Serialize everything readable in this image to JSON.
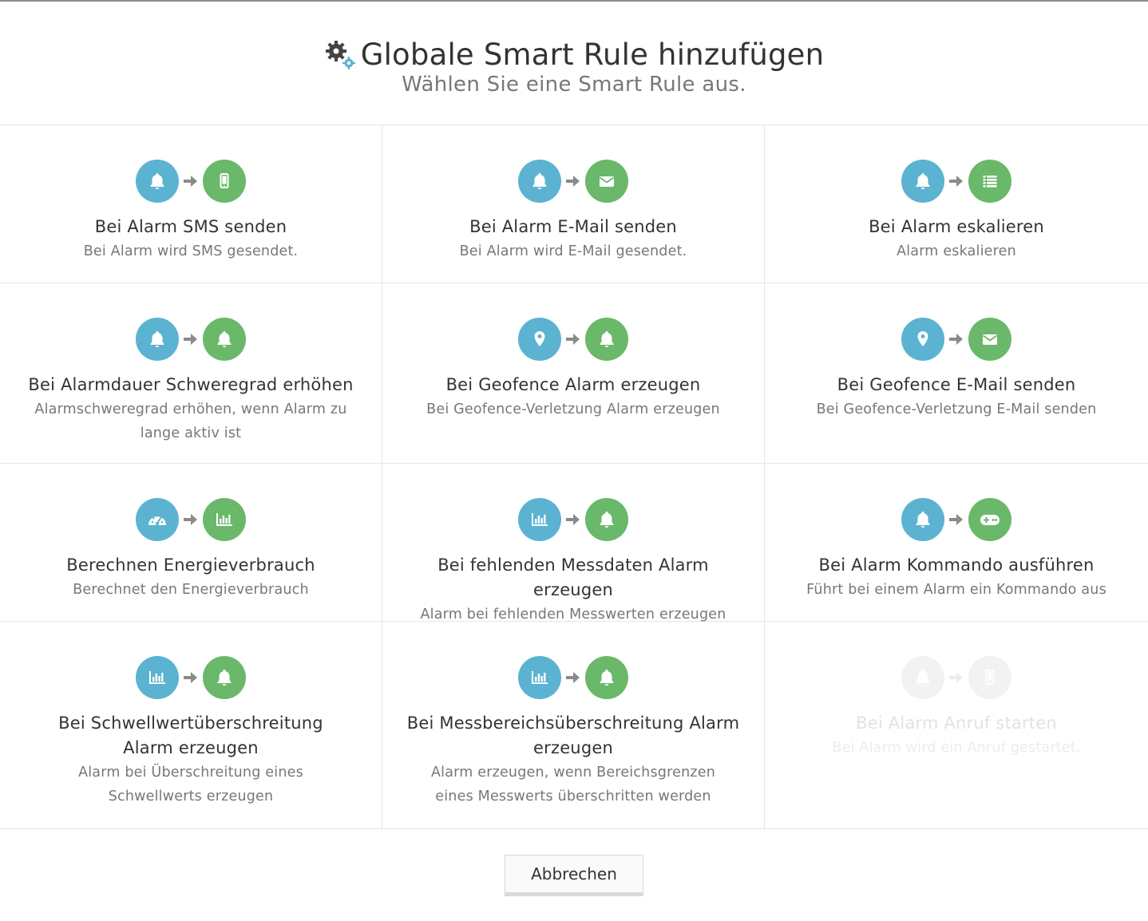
{
  "header": {
    "title": "Globale Smart Rule hinzufügen",
    "subtitle": "Wählen Sie eine Smart Rule aus."
  },
  "colors": {
    "trigger": "#5bb3d1",
    "action": "#6ab86a",
    "disabled": "#f2f2f2",
    "arrow": "#8a8a8a"
  },
  "rules": [
    {
      "title": "Bei Alarm SMS senden",
      "desc": "Bei Alarm wird SMS gesendet.",
      "from_icon": "bell-icon",
      "to_icon": "phone-icon",
      "enabled": true
    },
    {
      "title": "Bei Alarm E-Mail senden",
      "desc": "Bei Alarm wird E-Mail gesendet.",
      "from_icon": "bell-icon",
      "to_icon": "envelope-icon",
      "enabled": true
    },
    {
      "title": "Bei Alarm eskalieren",
      "desc": "Alarm eskalieren",
      "from_icon": "bell-icon",
      "to_icon": "list-icon",
      "enabled": true
    },
    {
      "title": "Bei Alarmdauer Schweregrad erhöhen",
      "desc": "Alarmschweregrad erhöhen, wenn Alarm zu lange aktiv ist",
      "from_icon": "bell-icon",
      "to_icon": "bell-icon",
      "enabled": true
    },
    {
      "title": "Bei Geofence Alarm erzeugen",
      "desc": "Bei Geofence-Verletzung Alarm erzeugen",
      "from_icon": "map-marker-icon",
      "to_icon": "bell-icon",
      "enabled": true
    },
    {
      "title": "Bei Geofence E-Mail senden",
      "desc": "Bei Geofence-Verletzung E-Mail senden",
      "from_icon": "map-marker-icon",
      "to_icon": "envelope-icon",
      "enabled": true
    },
    {
      "title": "Berechnen Energieverbrauch",
      "desc": "Berechnet den Energieverbrauch",
      "from_icon": "gauge-icon",
      "to_icon": "bar-chart-icon",
      "enabled": true
    },
    {
      "title": "Bei fehlenden Messdaten Alarm erzeugen",
      "desc": "Alarm bei fehlenden Messwerten erzeugen",
      "from_icon": "bar-chart-icon",
      "to_icon": "bell-icon",
      "enabled": true
    },
    {
      "title": "Bei Alarm Kommando ausführen",
      "desc": "Führt bei einem Alarm ein Kommando aus",
      "from_icon": "bell-icon",
      "to_icon": "gamepad-icon",
      "enabled": true
    },
    {
      "title": "Bei Schwellwertüberschreitung Alarm erzeugen",
      "desc": "Alarm bei Überschreitung eines Schwellwerts erzeugen",
      "from_icon": "bar-chart-icon",
      "to_icon": "bell-icon",
      "enabled": true
    },
    {
      "title": "Bei Messbereichsüberschreitung Alarm erzeugen",
      "desc": "Alarm erzeugen, wenn Bereichsgrenzen eines Messwerts überschritten werden",
      "from_icon": "bar-chart-icon",
      "to_icon": "bell-icon",
      "enabled": true
    },
    {
      "title": "Bei Alarm Anruf starten",
      "desc": "Bei Alarm wird ein Anruf gestartet.",
      "from_icon": "bell-icon",
      "to_icon": "phone-icon",
      "enabled": false
    }
  ],
  "footer": {
    "cancel_label": "Abbrechen"
  }
}
